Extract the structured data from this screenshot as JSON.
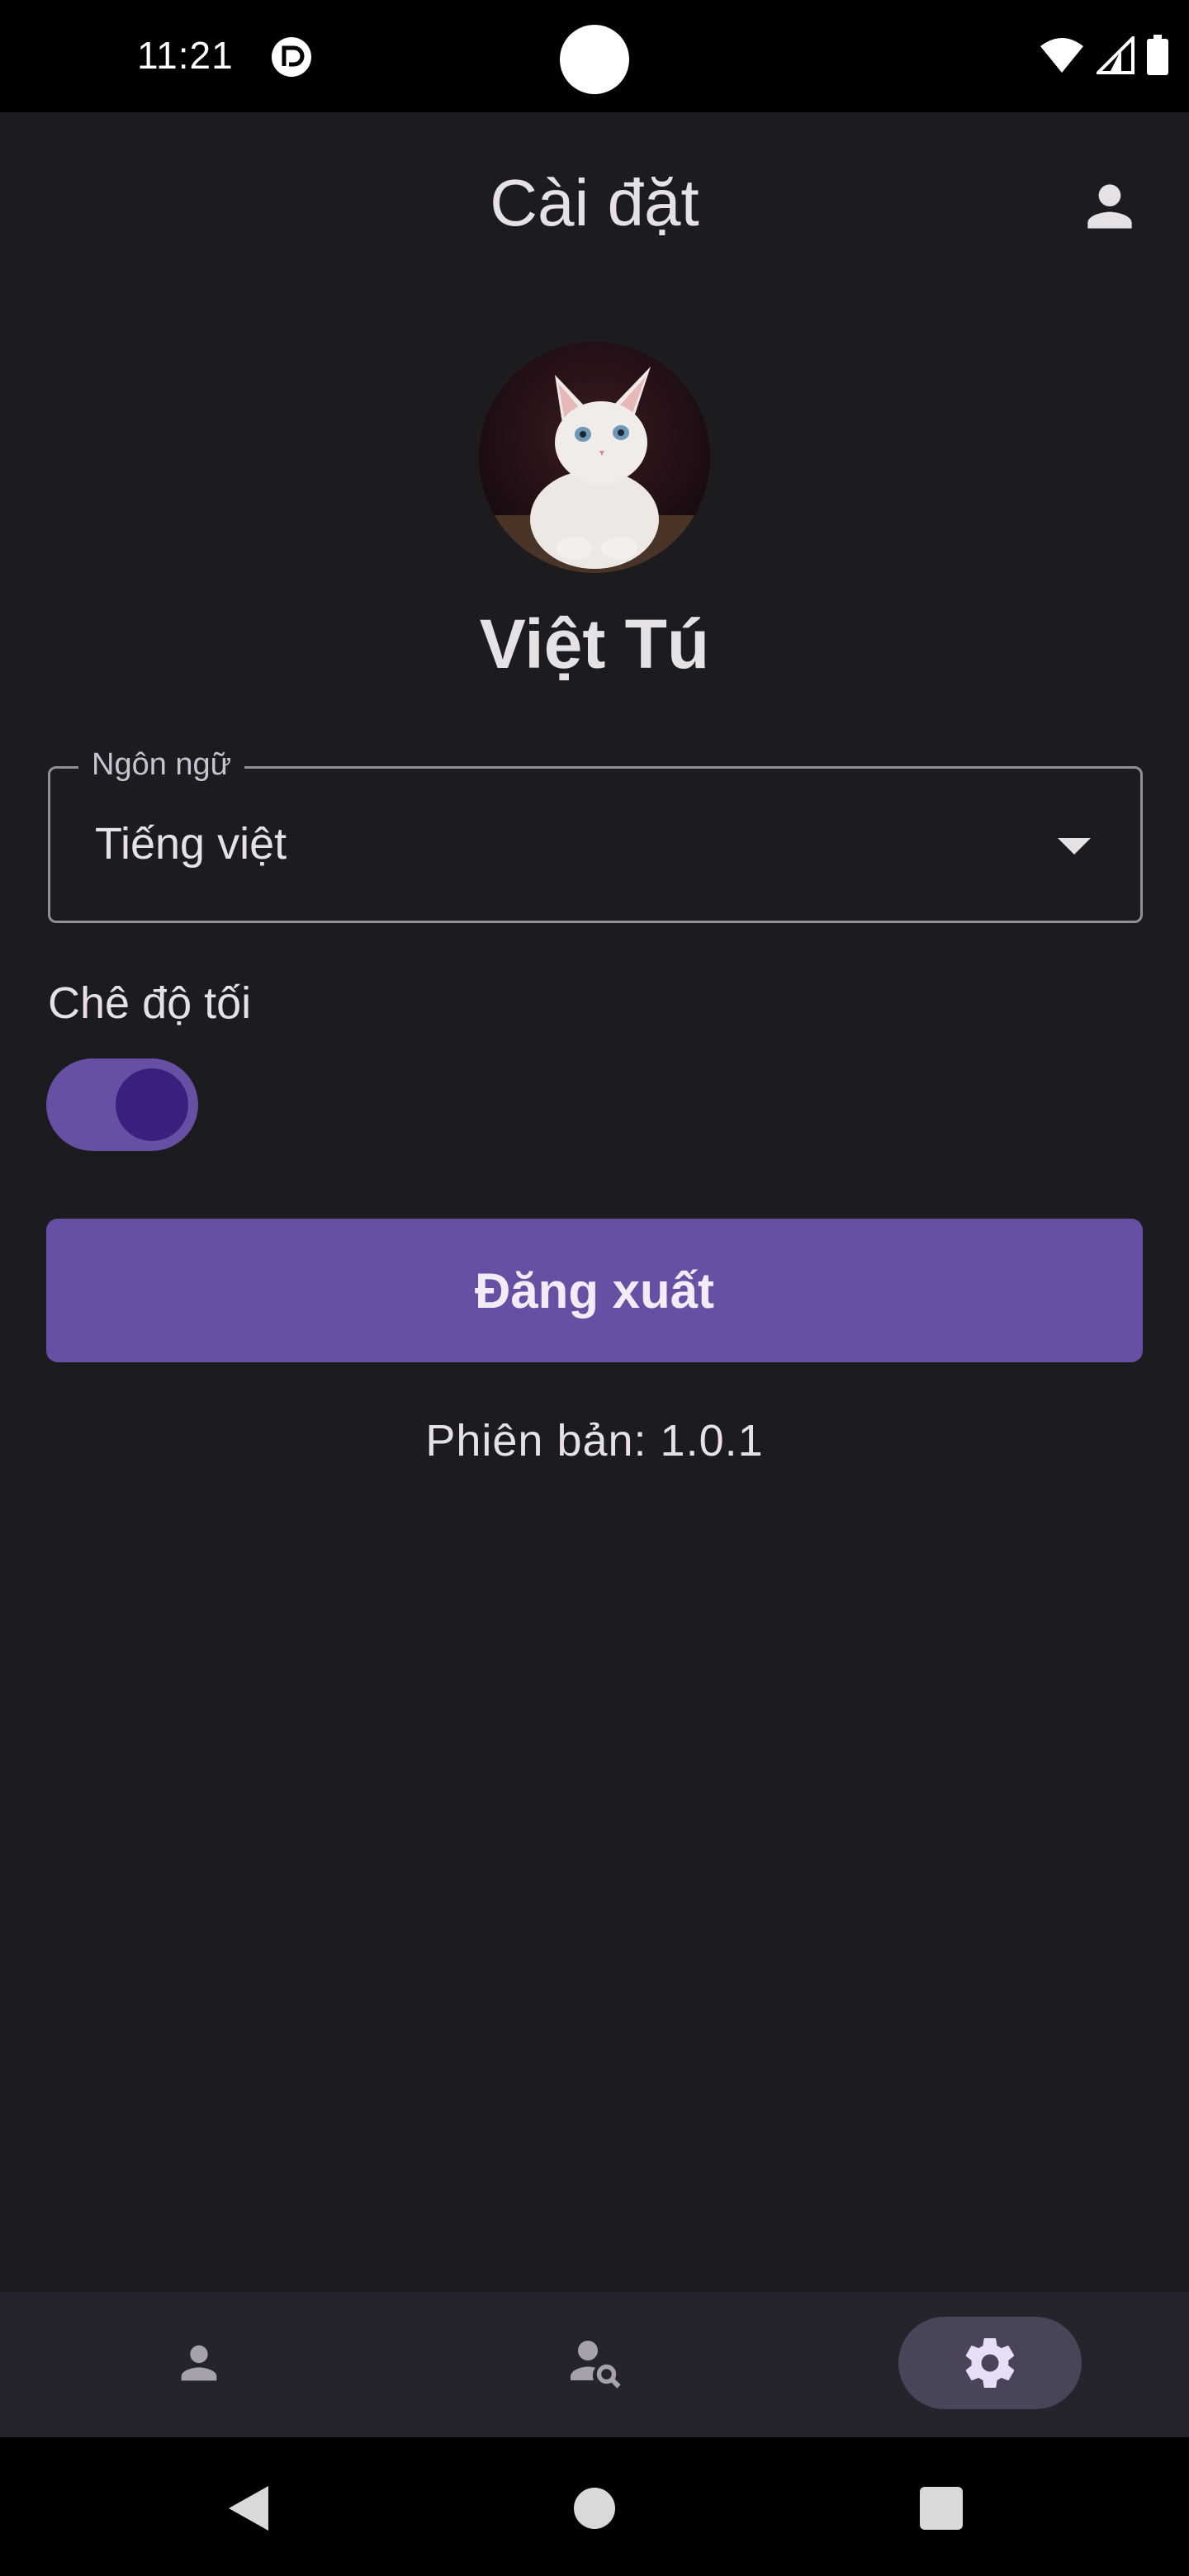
{
  "status_bar": {
    "time": "11:21",
    "app_icon": "pocket-casts-icon",
    "icons": [
      "wifi-icon",
      "signal-icon",
      "battery-icon"
    ]
  },
  "header": {
    "title": "Cài đặt",
    "account_icon": "account-icon"
  },
  "profile": {
    "avatar": "cat-avatar",
    "name": "Việt Tú"
  },
  "language": {
    "label": "Ngôn ngữ",
    "value": "Tiếng việt",
    "icon": "dropdown-arrow-icon"
  },
  "dark_mode": {
    "label": "Chê độ tối",
    "enabled": true
  },
  "logout": {
    "label": "Đăng xuất"
  },
  "version": {
    "text": "Phiên bản: 1.0.1"
  },
  "bottom_nav": {
    "items": [
      {
        "icon": "person-icon",
        "active": false
      },
      {
        "icon": "person-search-icon",
        "active": false
      },
      {
        "icon": "settings-gear-icon",
        "active": true
      }
    ]
  },
  "system_nav": {
    "buttons": [
      "back-icon",
      "home-icon",
      "recents-icon"
    ]
  },
  "colors": {
    "background": "#1c1b20",
    "accent": "#6750a4",
    "toggle_thumb": "#3b1f7e",
    "nav_background": "#25232b",
    "nav_active": "#4a4458"
  }
}
